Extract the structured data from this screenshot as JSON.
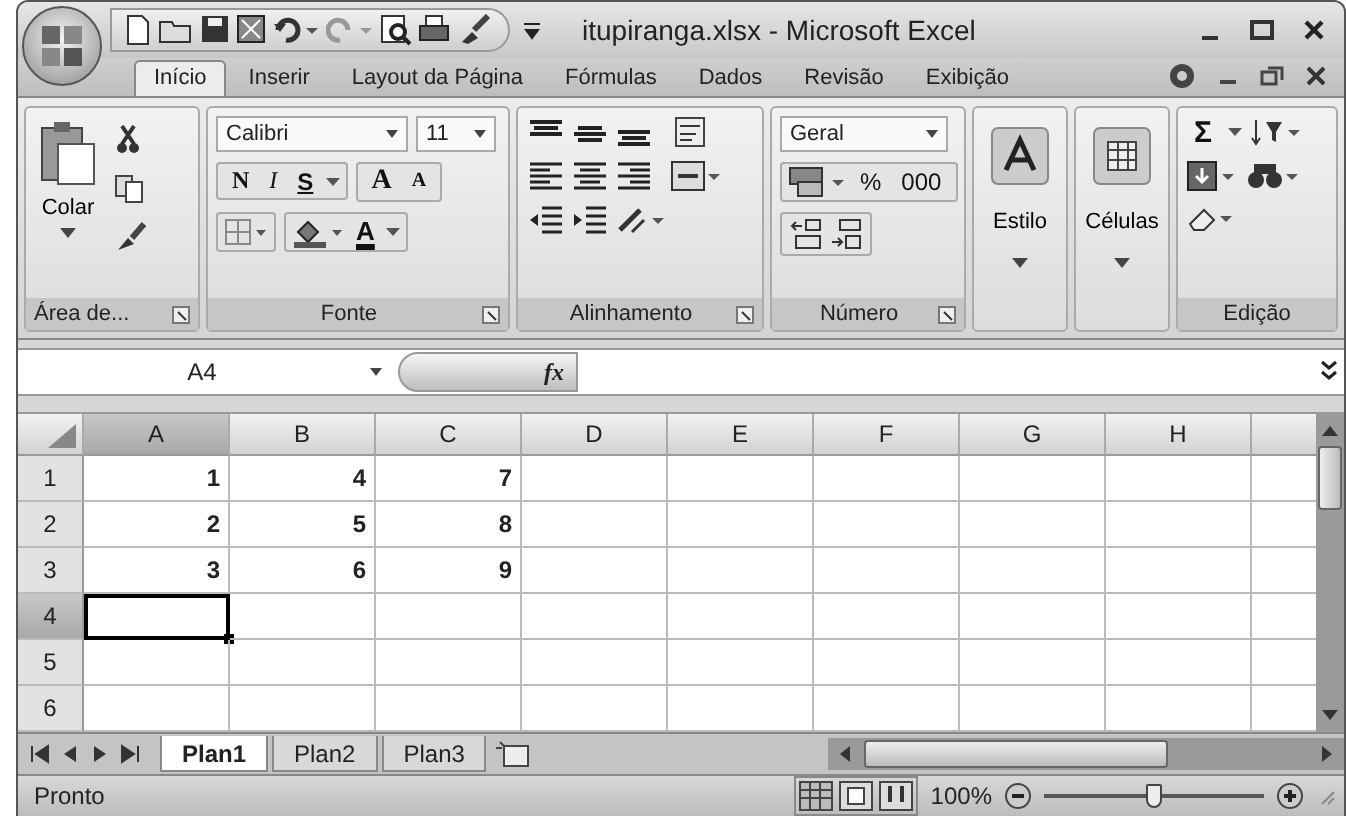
{
  "window": {
    "title": "itupiranga.xlsx - Microsoft Excel"
  },
  "ribbon_tabs": [
    {
      "label": "Início",
      "selected": true
    },
    {
      "label": "Inserir",
      "selected": false
    },
    {
      "label": "Layout da Página",
      "selected": false
    },
    {
      "label": "Fórmulas",
      "selected": false
    },
    {
      "label": "Dados",
      "selected": false
    },
    {
      "label": "Revisão",
      "selected": false
    },
    {
      "label": "Exibição",
      "selected": false
    }
  ],
  "ribbon": {
    "clipboard": {
      "label": "Área de...",
      "paste": "Colar"
    },
    "font": {
      "label": "Fonte",
      "family": "Calibri",
      "size": "11",
      "bold": "N",
      "italic": "I",
      "underline": "S",
      "grow": "A",
      "shrink": "A",
      "tint": "A"
    },
    "alignment": {
      "label": "Alinhamento"
    },
    "number": {
      "label": "Número",
      "format": "Geral",
      "percent": "%",
      "thousands": "000"
    },
    "styles": {
      "label": "Estilo"
    },
    "cells": {
      "label": "Células"
    },
    "editing": {
      "label": "Edição",
      "sum": "Σ"
    }
  },
  "formula_bar": {
    "name_box": "A4",
    "fx": "fx"
  },
  "sheet": {
    "columns": [
      {
        "label": "A",
        "selected": true
      },
      {
        "label": "B",
        "selected": false
      },
      {
        "label": "C",
        "selected": false
      },
      {
        "label": "D",
        "selected": false
      },
      {
        "label": "E",
        "selected": false
      },
      {
        "label": "F",
        "selected": false
      },
      {
        "label": "G",
        "selected": false
      },
      {
        "label": "H",
        "selected": false
      }
    ],
    "rows": [
      {
        "header": "1",
        "selected": false,
        "cells": [
          "1",
          "4",
          "7"
        ]
      },
      {
        "header": "2",
        "selected": false,
        "cells": [
          "2",
          "5",
          "8"
        ]
      },
      {
        "header": "3",
        "selected": false,
        "cells": [
          "3",
          "6",
          "9"
        ]
      },
      {
        "header": "4",
        "selected": true
      },
      {
        "header": "5",
        "selected": false
      },
      {
        "header": "6",
        "selected": false
      }
    ]
  },
  "sheet_tabs": [
    {
      "label": "Plan1",
      "selected": true
    },
    {
      "label": "Plan2",
      "selected": false
    },
    {
      "label": "Plan3",
      "selected": false
    }
  ],
  "status_bar": {
    "status": "Pronto",
    "zoom": "100%",
    "zoom_slider": {
      "level": 0.5
    }
  }
}
